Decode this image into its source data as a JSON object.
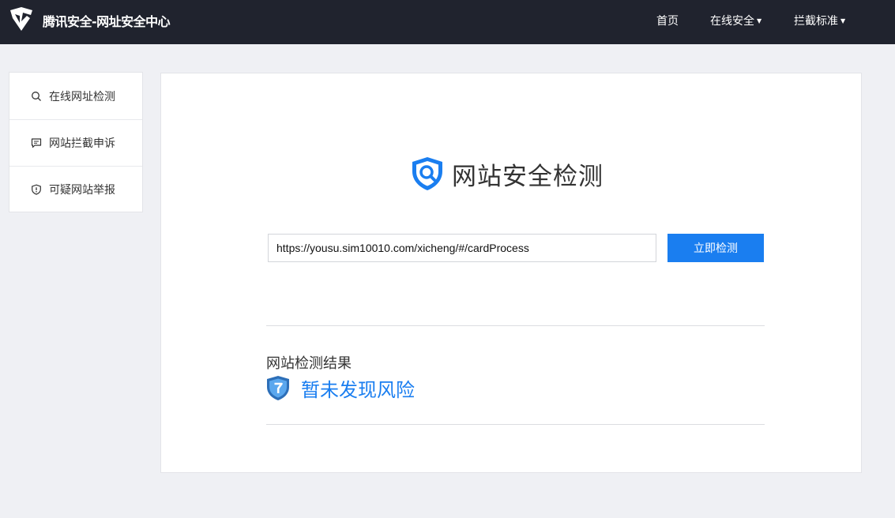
{
  "header": {
    "brand": "腾讯安全-网址安全中心",
    "nav": [
      {
        "label": "首页",
        "icon": ""
      },
      {
        "label": "在线安全",
        "icon": "caret-down-icon"
      },
      {
        "label": "拦截标准",
        "icon": "caret-down-icon"
      }
    ]
  },
  "sidebar": {
    "items": [
      {
        "label": "在线网址检测",
        "icon": "search-icon"
      },
      {
        "label": "网站拦截申诉",
        "icon": "message-icon"
      },
      {
        "label": "可疑网站举报",
        "icon": "shield-alert-icon"
      }
    ]
  },
  "main": {
    "title": "网站安全检测",
    "url_value": "https://yousu.sim10010.com/xicheng/#/cardProcess",
    "check_button": "立即检测",
    "result_label": "网站检测结果",
    "result_text": "暂未发现风险"
  },
  "colors": {
    "topbar": "#20232e",
    "accent": "#1a7ef0",
    "background": "#eff0f4"
  }
}
